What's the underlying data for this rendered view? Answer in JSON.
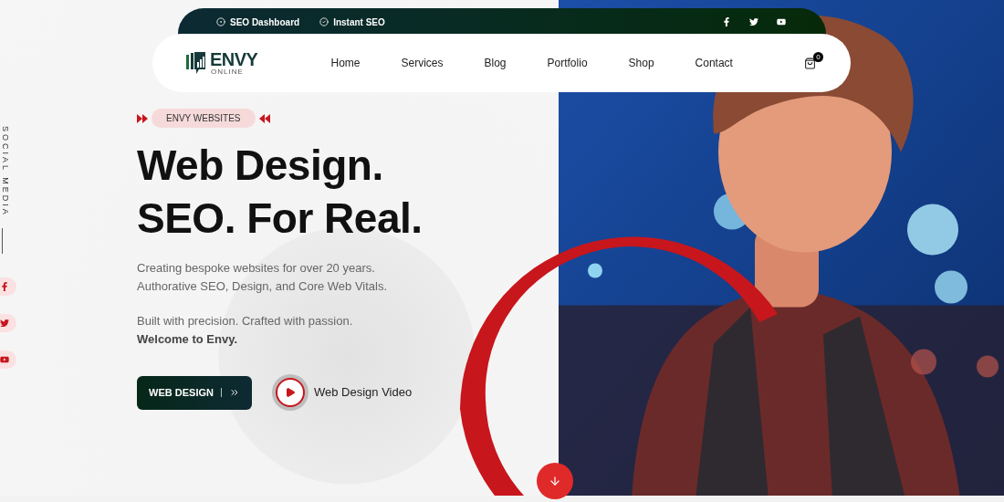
{
  "topbar": {
    "links": [
      {
        "label": "SEO Dashboard",
        "kind": "target"
      },
      {
        "label": "Instant SEO",
        "kind": "check"
      }
    ],
    "social": [
      {
        "kind": "facebook"
      },
      {
        "kind": "twitter"
      },
      {
        "kind": "youtube"
      }
    ]
  },
  "logo": {
    "name": "ENVY",
    "tagline": "ONLINE"
  },
  "nav": {
    "items": [
      "Home",
      "Services",
      "Blog",
      "Portfolio",
      "Shop",
      "Contact"
    ]
  },
  "cart": {
    "count": "0"
  },
  "social_sidebar": {
    "label": "SOCIAL MEDIA",
    "icons": [
      {
        "kind": "facebook"
      },
      {
        "kind": "twitter"
      },
      {
        "kind": "youtube"
      }
    ]
  },
  "hero": {
    "badge": "ENVY WEBSITES",
    "headline": [
      "Web Design.",
      "SEO. For Real."
    ],
    "intro": [
      "Creating bespoke websites for over 20 years.",
      "Authorative SEO, Design, and Core Web Vitals."
    ],
    "tagline": "Built with precision. Crafted with passion.",
    "welcome": "Welcome to Envy.",
    "primary_button": "WEB DESIGN",
    "video_link": "Web Design Video"
  }
}
